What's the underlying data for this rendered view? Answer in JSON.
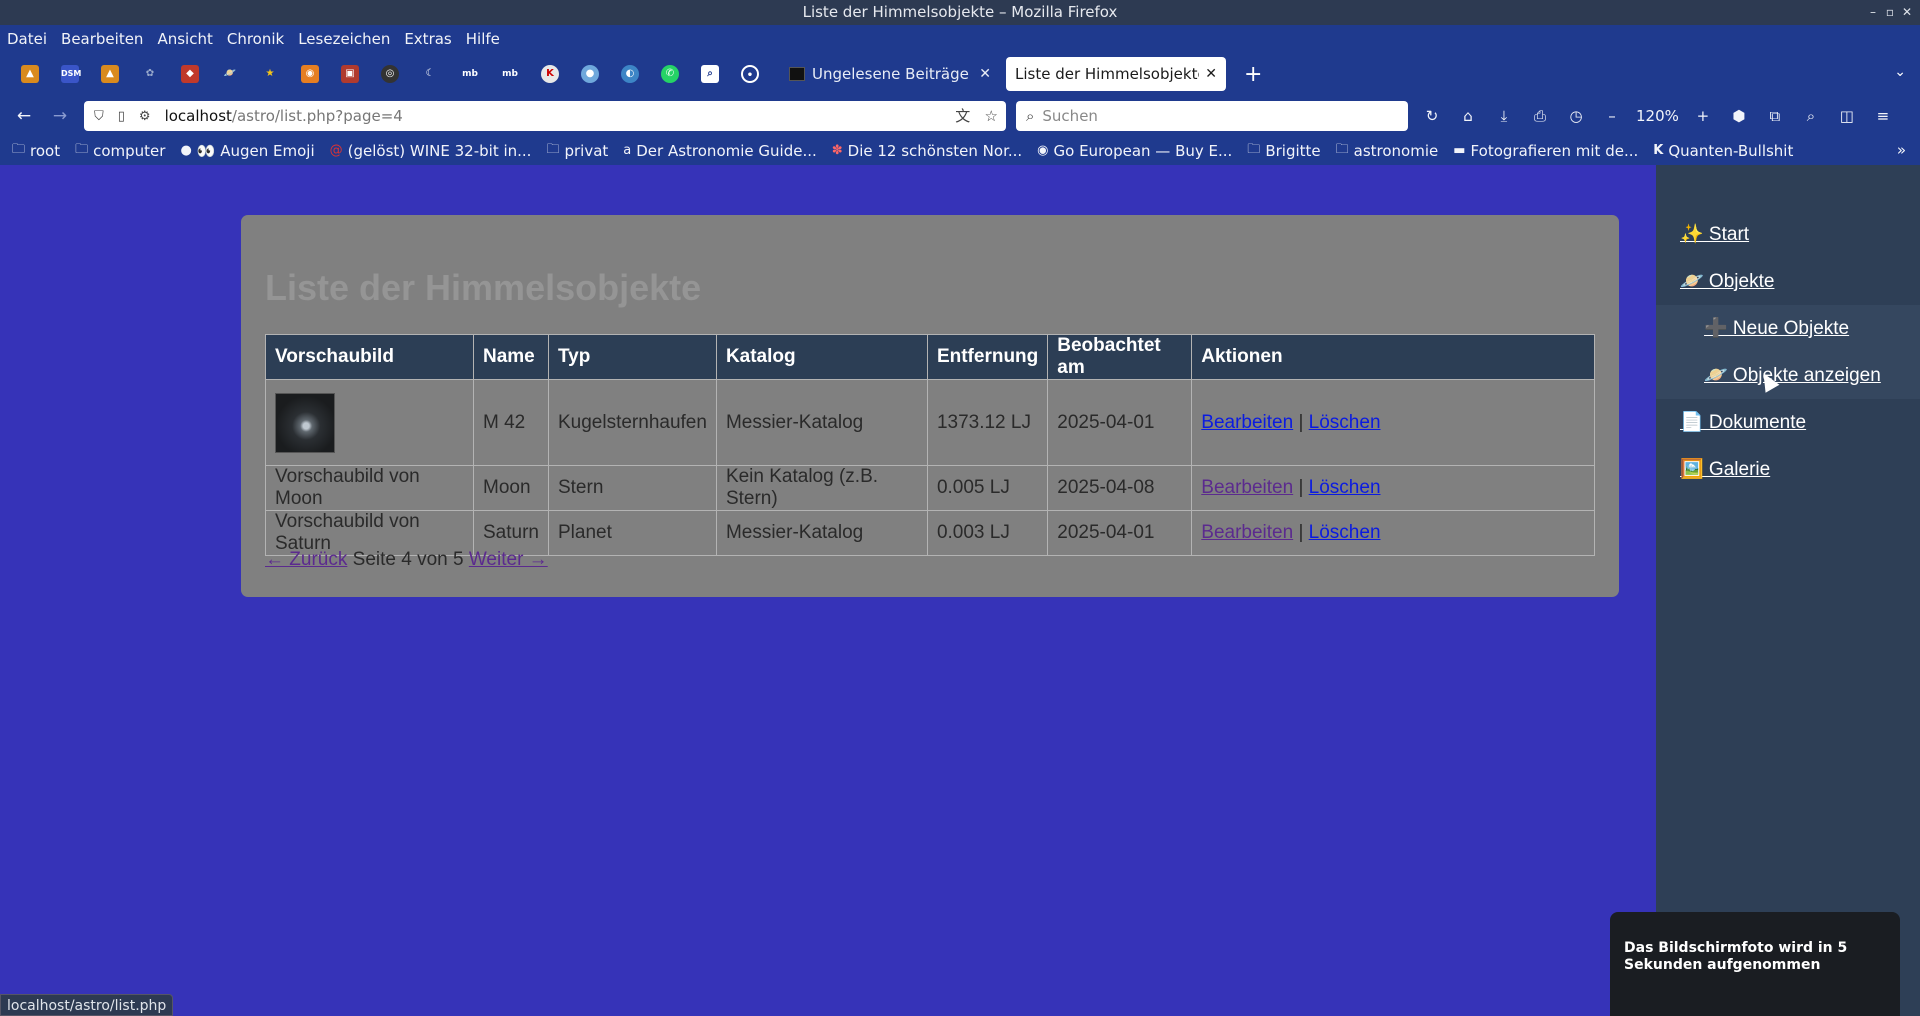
{
  "window": {
    "title": "Liste der Himmelsobjekte – Mozilla Firefox"
  },
  "menu": [
    "Datei",
    "Bearbeiten",
    "Ansicht",
    "Chronik",
    "Lesezeichen",
    "Extras",
    "Hilfe"
  ],
  "tabs": {
    "inactive_label": "Ungelesene Beiträge | Fo",
    "active_label": "Liste der Himmelsobjekte"
  },
  "url": {
    "host": "localhost",
    "path": "/astro/list.php?page=4"
  },
  "search": {
    "placeholder": "Suchen"
  },
  "zoom": "120%",
  "bookmarks": [
    "root",
    "computer",
    "👀 Augen Emoji",
    "(gelöst) WINE 32-bit in...",
    "privat",
    "Der Astronomie Guide...",
    "Die 12 schönsten Nor...",
    "Go European — Buy E...",
    "Brigitte",
    "astronomie",
    "Fotografieren mit de...",
    "Quanten-Bullshit"
  ],
  "page": {
    "heading": "Liste der Himmelsobjekte",
    "columns": [
      "Vorschaubild",
      "Name",
      "Typ",
      "Katalog",
      "Entfernung",
      "Beobachtet am",
      "Aktionen"
    ],
    "rows": [
      {
        "preview": "",
        "name": "M 42",
        "type": "Kugelsternhaufen",
        "catalog": "Messier-Katalog",
        "distance": "1373.12 LJ",
        "observed": "2025-04-01",
        "edit": "Bearbeiten",
        "sep": "|",
        "delete": "Löschen"
      },
      {
        "preview": "Vorschaubild von Moon",
        "name": "Moon",
        "type": "Stern",
        "catalog": "Kein Katalog (z.B. Stern)",
        "distance": "0.005 LJ",
        "observed": "2025-04-08",
        "edit": "Bearbeiten",
        "sep": "|",
        "delete": "Löschen"
      },
      {
        "preview": "Vorschaubild von Saturn",
        "name": "Saturn",
        "type": "Planet",
        "catalog": "Messier-Katalog",
        "distance": "0.003 LJ",
        "observed": "2025-04-01",
        "edit": "Bearbeiten",
        "sep": "|",
        "delete": "Löschen"
      }
    ],
    "pager": {
      "prev": "← Zurück",
      "info": "Seite 4 von 5",
      "next": "Weiter →"
    }
  },
  "sidebar": {
    "start": "✨ Start",
    "objects": "🪐 Objekte",
    "new_objects": "➕ Neue Objekte",
    "show_objects": "🪐 Objekte anzeigen",
    "documents": "📄 Dokumente",
    "gallery": "🖼️ Galerie"
  },
  "statusbar": "localhost/astro/list.php",
  "toast": "Das Bildschirmfoto wird in 5 Sekunden aufgenommen"
}
